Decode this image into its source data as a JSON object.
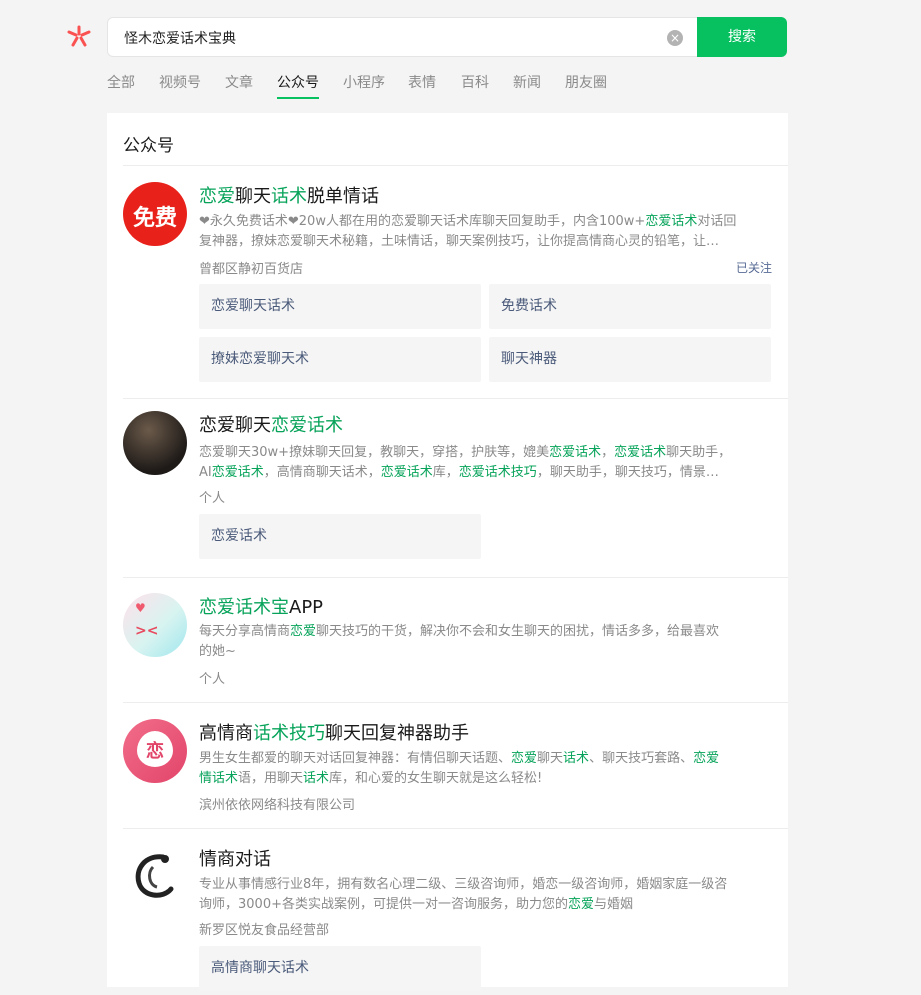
{
  "search": {
    "query": "怪木恋爱话术宝典",
    "button_label": "搜索",
    "clear_icon": "clear-icon",
    "logo_icon": "wechat-search-logo-icon"
  },
  "tabs": [
    "全部",
    "视频号",
    "文章",
    "公众号",
    "小程序",
    "表情",
    "百科",
    "新闻",
    "朋友圈"
  ],
  "active_tab": "公众号",
  "section_title": "公众号",
  "accent_color": "#07c160",
  "highlight_color": "#07a35a",
  "results": [
    {
      "title_parts": [
        [
          "恋爱",
          true
        ],
        [
          "聊天",
          false
        ],
        [
          "话术",
          true
        ],
        [
          "脱单情话",
          false
        ]
      ],
      "desc_line1": [
        [
          "❤永久免费话术❤20w人都在用的恋爱聊天话术库聊天回复助手，内含100w+",
          false
        ],
        [
          "恋爱话术",
          true
        ],
        [
          "对话回",
          false
        ]
      ],
      "desc_line2": [
        [
          "复神器，撩妹恋爱聊天术秘籍，土味情话，聊天案例技巧，让你提高情商心灵的铅笔，让…",
          false
        ]
      ],
      "source": "曾都区静初百货店",
      "status": "已关注",
      "avatar_text": "免费",
      "chips": [
        "恋爱聊天话术",
        "免费话术",
        "撩妹恋爱聊天术",
        "聊天神器"
      ]
    },
    {
      "title_parts": [
        [
          "恋爱聊天",
          false
        ],
        [
          "恋爱话术",
          true
        ]
      ],
      "desc_line1": [
        [
          "恋爱聊天30w+撩妹聊天回复，教聊天，穿搭，护肤等，媲美",
          false
        ],
        [
          "恋爱话术",
          true
        ],
        [
          "，",
          false
        ],
        [
          "恋爱话术",
          true
        ],
        [
          "聊天助手，",
          false
        ]
      ],
      "desc_line2": [
        [
          "AI",
          false
        ],
        [
          "恋爱话术",
          true
        ],
        [
          "，高情商聊天话术，",
          false
        ],
        [
          "恋爱话术",
          true
        ],
        [
          "库，",
          false
        ],
        [
          "恋爱话术技巧",
          true
        ],
        [
          "，聊天助手，聊天技巧，情景…",
          false
        ]
      ],
      "source": "个人",
      "chips": [
        "恋爱话术"
      ]
    },
    {
      "title_parts": [
        [
          "恋爱话术宝",
          true
        ],
        [
          "APP",
          false
        ]
      ],
      "desc_line1": [
        [
          "每天分享高情商",
          false
        ],
        [
          "恋爱",
          true
        ],
        [
          "聊天技巧的干货，解决你不会和女生聊天的困扰，情话多多，给最喜欢",
          false
        ]
      ],
      "desc_line2": [
        [
          "的她~",
          false
        ]
      ],
      "source": "个人",
      "chips": []
    },
    {
      "title_parts": [
        [
          "高情商",
          false
        ],
        [
          "话术技巧",
          true
        ],
        [
          "聊天回复神器助手",
          false
        ]
      ],
      "desc_line1": [
        [
          "男生女生都爱的聊天对话回复神器：有情侣聊天话题、",
          false
        ],
        [
          "恋爱",
          true
        ],
        [
          "聊天",
          false
        ],
        [
          "话术",
          true
        ],
        [
          "、聊天技巧套路、",
          false
        ],
        [
          "恋爱",
          true
        ]
      ],
      "desc_line2": [
        [
          "情话术",
          true
        ],
        [
          "语，用聊天",
          false
        ],
        [
          "话术",
          true
        ],
        [
          "库，和心爱的女生聊天就是这么轻松!",
          false
        ]
      ],
      "source": "滨州依依网络科技有限公司",
      "avatar_text": "恋",
      "chips": []
    },
    {
      "title_parts": [
        [
          "情商对话",
          false
        ]
      ],
      "desc_line1": [
        [
          "专业从事情感行业8年，拥有数名心理二级、三级咨询师，婚恋一级咨询师，婚姻家庭一级咨",
          false
        ]
      ],
      "desc_line2": [
        [
          "询师，3000+各类实战案例，可提供一对一咨询服务，助力您的",
          false
        ],
        [
          "恋爱",
          true
        ],
        [
          "与婚姻",
          false
        ]
      ],
      "source": "新罗区悦友食品经营部",
      "chips": [
        "高情商聊天话术"
      ]
    }
  ]
}
